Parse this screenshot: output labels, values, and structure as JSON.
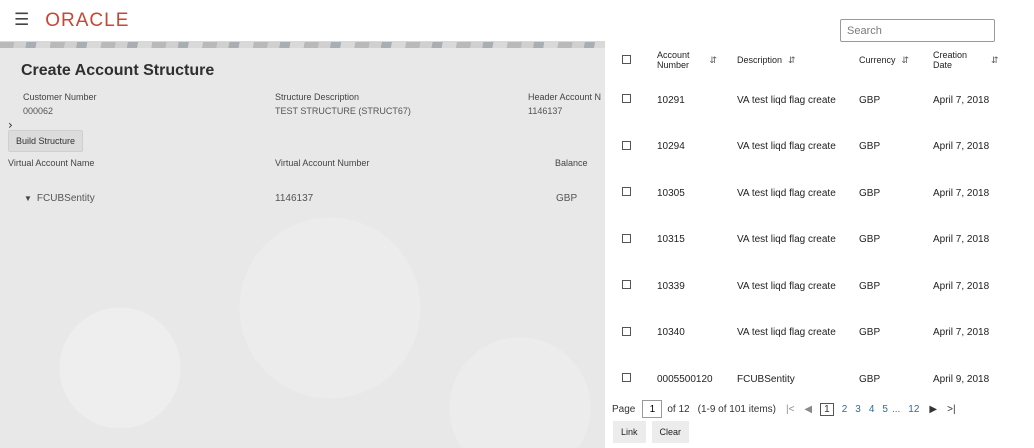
{
  "header": {
    "logo": "ORACLE"
  },
  "page": {
    "title": "Create Account Structure",
    "customer_number": {
      "label": "Customer Number",
      "value": "000062"
    },
    "structure_description": {
      "label": "Structure Description",
      "value": "TEST STRUCTURE (STRUCT67)"
    },
    "header_account": {
      "label": "Header Account N",
      "value": "1146137"
    },
    "build_button": "Build Structure",
    "grid": {
      "headers": [
        "Virtual Account Name",
        "Virtual Account Number",
        "Balance"
      ],
      "row": {
        "name": "FCUBSentity",
        "number": "1146137",
        "balance": "GBP"
      }
    }
  },
  "panel": {
    "search_placeholder": "Search",
    "columns": {
      "account": [
        "Account",
        "Number"
      ],
      "description": "Description",
      "currency": "Currency",
      "creation": [
        "Creation",
        "Date"
      ]
    },
    "rows": [
      {
        "account": "10291",
        "description": "VA test liqd flag create",
        "currency": "GBP",
        "date": "April 7, 2018"
      },
      {
        "account": "10294",
        "description": "VA test liqd flag create",
        "currency": "GBP",
        "date": "April 7, 2018"
      },
      {
        "account": "10305",
        "description": "VA test liqd flag create",
        "currency": "GBP",
        "date": "April 7, 2018"
      },
      {
        "account": "10315",
        "description": "VA test liqd flag create",
        "currency": "GBP",
        "date": "April 7, 2018"
      },
      {
        "account": "10339",
        "description": "VA test liqd flag create",
        "currency": "GBP",
        "date": "April 7, 2018"
      },
      {
        "account": "10340",
        "description": "VA test liqd flag create",
        "currency": "GBP",
        "date": "April 7, 2018"
      },
      {
        "account": "0005500120",
        "description": "FCUBSentity",
        "currency": "GBP",
        "date": "April 9, 2018"
      }
    ],
    "pagination": {
      "label": "Page",
      "current": "1",
      "of_text": "of 12",
      "items_text": "(1-9 of 101 items)",
      "pages": [
        "1",
        "2",
        "3",
        "4",
        "5"
      ],
      "ellipsis": "...",
      "last": "12"
    },
    "actions": {
      "link": "Link",
      "clear": "Clear"
    }
  }
}
